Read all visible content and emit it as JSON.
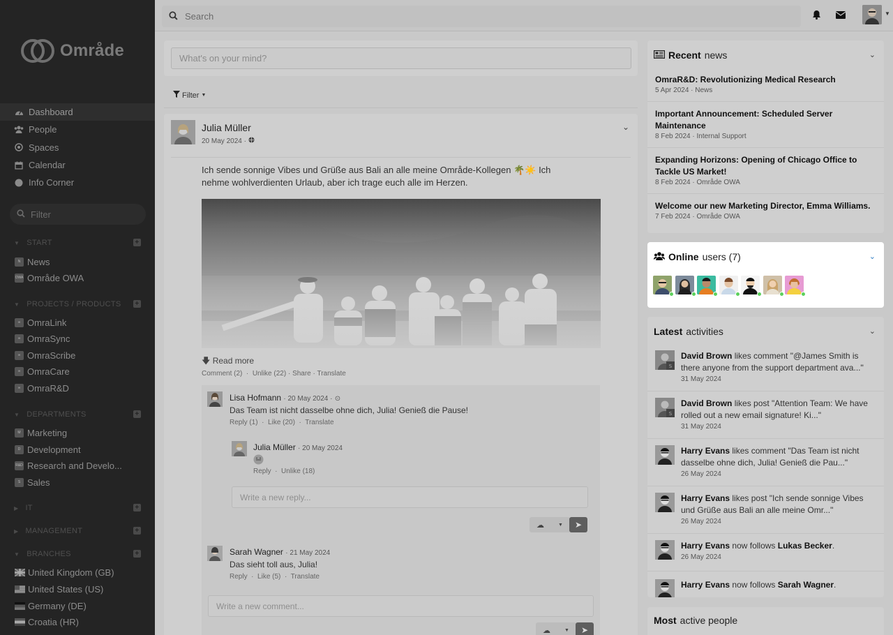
{
  "app": {
    "name": "Område"
  },
  "search": {
    "placeholder": "Search"
  },
  "nav": [
    {
      "label": "Dashboard",
      "icon": "dashboard-icon"
    },
    {
      "label": "People",
      "icon": "people-icon"
    },
    {
      "label": "Spaces",
      "icon": "spaces-icon"
    },
    {
      "label": "Calendar",
      "icon": "calendar-icon"
    },
    {
      "label": "Info Corner",
      "icon": "info-icon"
    }
  ],
  "sidebar_filter": {
    "placeholder": "Filter"
  },
  "sections": {
    "start": {
      "title": "START",
      "items": [
        {
          "label": "News",
          "badge": "N"
        },
        {
          "label": "Område OWA",
          "badge": "OWA"
        }
      ]
    },
    "projects": {
      "title": "PROJECTS / PRODUCTS",
      "items": [
        {
          "label": "OmraLink"
        },
        {
          "label": "OmraSync"
        },
        {
          "label": "OmraScribe"
        },
        {
          "label": "OmraCare"
        },
        {
          "label": "OmraR&D"
        }
      ]
    },
    "departments": {
      "title": "DEPARTMENTS",
      "items": [
        {
          "label": "Marketing",
          "badge": "M"
        },
        {
          "label": "Development",
          "badge": "D"
        },
        {
          "label": "Research and Develo...",
          "badge": "R&D"
        },
        {
          "label": "Sales",
          "badge": "S"
        }
      ]
    },
    "it": {
      "title": "IT"
    },
    "management": {
      "title": "MANAGEMENT"
    },
    "branches": {
      "title": "BRANCHES",
      "items": [
        {
          "label": "United Kingdom (GB)"
        },
        {
          "label": "United States (US)"
        },
        {
          "label": "Germany (DE)"
        },
        {
          "label": "Croatia (HR)"
        }
      ]
    }
  },
  "composer": {
    "placeholder": "What's on your mind?"
  },
  "filter": {
    "label": "Filter"
  },
  "post": {
    "author": "Julia Müller",
    "date": "20 May 2024 ·",
    "text": "Ich sende sonnige Vibes und Grüße aus Bali an alle meine Område-Kollegen 🌴☀️ Ich nehme wohlverdienten Urlaub, aber ich trage euch alle im Herzen.",
    "read_more": "Read more",
    "actions": {
      "comment": "Comment (2)",
      "unlike": "Unlike (22)",
      "share": "Share",
      "translate": "Translate"
    }
  },
  "comments": [
    {
      "author": "Lisa Hofmann",
      "date": "· 20 May 2024 ·",
      "text": "Das Team ist nicht dasselbe ohne dich, Julia! Genieß die Pause!",
      "reply": "Reply (1)",
      "like": "Like (20)",
      "translate": "Translate"
    },
    {
      "author": "Sarah Wagner",
      "date": "· 21 May 2024",
      "text": "Das sieht toll aus, Julia!",
      "reply": "Reply",
      "like": "Like (5)",
      "translate": "Translate"
    }
  ],
  "reply": {
    "author": "Julia Müller",
    "date": "· 20 May 2024",
    "reply": "Reply",
    "unlike": "Unlike (18)"
  },
  "reply_input": {
    "placeholder": "Write a new reply..."
  },
  "comment_input": {
    "placeholder": "Write a new comment..."
  },
  "recent_news": {
    "title_bold": "Recent",
    "title_rest": "news",
    "items": [
      {
        "title": "OmraR&D: Revolutionizing Medical Research",
        "meta": "5 Apr 2024 · News"
      },
      {
        "title": "Important Announcement: Scheduled Server Maintenance",
        "meta": "8 Feb 2024 · Internal Support"
      },
      {
        "title": "Expanding Horizons: Opening of Chicago Office to Tackle US Market!",
        "meta": "8 Feb 2024 · Område OWA"
      },
      {
        "title": "Welcome our new Marketing Director, Emma Williams.",
        "meta": "7 Feb 2024 · Område OWA"
      }
    ]
  },
  "online_users": {
    "title_bold": "Online",
    "title_rest": "users (7)",
    "count": 7
  },
  "latest_activities": {
    "title_bold": "Latest",
    "title_rest": "activities",
    "items": [
      {
        "user": "David Brown",
        "action": "likes comment \"@James Smith is there anyone from the support department ava...\"",
        "date": "31 May 2024"
      },
      {
        "user": "David Brown",
        "action": "likes post \"Attention Team: We have rolled out a new email signature! Ki...\"",
        "date": "31 May 2024"
      },
      {
        "user": "Harry Evans",
        "action": "likes comment \"Das Team ist nicht dasselbe ohne dich, Julia! Genieß die Pau...\"",
        "date": "26 May 2024"
      },
      {
        "user": "Harry Evans",
        "action": "likes post \"Ich sende sonnige Vibes und Grüße aus Bali an alle meine Omr...\"",
        "date": "26 May 2024"
      },
      {
        "user": "Harry Evans",
        "action": "now follows",
        "target": "Lukas Becker",
        "date": "26 May 2024"
      },
      {
        "user": "Harry Evans",
        "action": "now follows",
        "target": "Sarah Wagner",
        "date": ""
      }
    ]
  },
  "most_active": {
    "title_bold": "Most",
    "title_rest": "active people"
  },
  "colors": {
    "accent": "#2f7cc4",
    "online": "#5cd05c",
    "overlay": "#c9c9c9"
  }
}
